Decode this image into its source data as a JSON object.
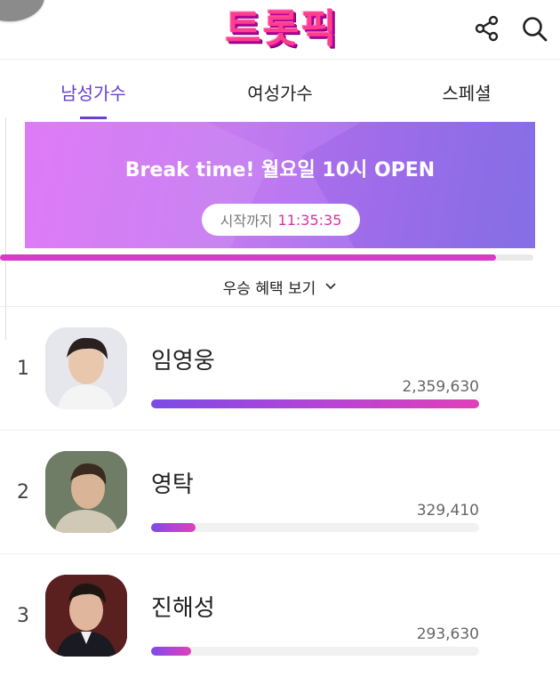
{
  "app": {
    "logo_text": "트롯픽"
  },
  "tabs": [
    {
      "label": "남성가수",
      "active": true
    },
    {
      "label": "여성가수",
      "active": false
    },
    {
      "label": "스페셜",
      "active": false
    }
  ],
  "banner": {
    "title": "Break time! 월요일 10시 OPEN",
    "countdown_label": "시작까지",
    "countdown_time": "11:35:35",
    "progress": 0.93
  },
  "benefit_link": {
    "label": "우승 혜택 보기"
  },
  "ranking": [
    {
      "rank": "1",
      "name": "임영웅",
      "votes": "2,359,630",
      "vote_count": 2359630
    },
    {
      "rank": "2",
      "name": "영탁",
      "votes": "329,410",
      "vote_count": 329410
    },
    {
      "rank": "3",
      "name": "진해성",
      "votes": "293,630",
      "vote_count": 293630
    }
  ],
  "icons": {
    "share": "share-icon",
    "search": "search-icon",
    "chevron": "chevron-down-icon"
  },
  "colors": {
    "accent": "#6b3fd1",
    "countdown": "#d633a8",
    "progress": "#d83cc7"
  }
}
